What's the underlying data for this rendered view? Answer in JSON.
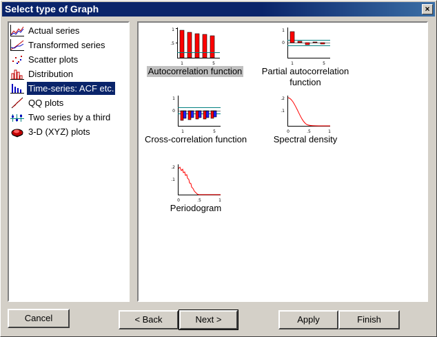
{
  "window": {
    "title": "Select type of Graph",
    "close_label": "×"
  },
  "graph_types": [
    {
      "label": "Actual series",
      "icon": "actual-series-icon"
    },
    {
      "label": "Transformed series",
      "icon": "transformed-series-icon"
    },
    {
      "label": "Scatter plots",
      "icon": "scatter-plots-icon"
    },
    {
      "label": "Distribution",
      "icon": "distribution-icon"
    },
    {
      "label": "Time-series: ACF etc.",
      "icon": "time-series-icon",
      "selected": true
    },
    {
      "label": "QQ plots",
      "icon": "qq-plots-icon"
    },
    {
      "label": "Two series by a third",
      "icon": "two-series-icon"
    },
    {
      "label": "3-D (XYZ) plots",
      "icon": "3d-plots-icon"
    }
  ],
  "graphs": {
    "acf": {
      "caption": "Autocorrelation function",
      "selected": true
    },
    "pacf": {
      "caption_line1": "Partial autocorrelation",
      "caption_line2": "function"
    },
    "ccf": {
      "caption": "Cross-correlation function"
    },
    "spectral": {
      "caption": "Spectral density"
    },
    "periodogram": {
      "caption": "Periodogram"
    }
  },
  "thumb_labels": {
    "acf_y_top": "1",
    "acf_y_mid": ".5",
    "acf_x_1": "1",
    "acf_x_5": "5",
    "pacf_y_top": "1",
    "pacf_y_mid": "0",
    "pacf_x_1": "1",
    "pacf_x_5": "5",
    "ccf_y_top": "1",
    "ccf_y_mid": "0",
    "ccf_x_1": "1",
    "ccf_x_5": "5",
    "sd_y_top": ".2",
    "sd_y_mid": ".1",
    "sd_x_0": "0",
    "sd_x_5": ".5",
    "sd_x_1": "1",
    "pg_y_top": ".2",
    "pg_y_mid": ".1",
    "pg_x_0": "0",
    "pg_x_5": ".5",
    "pg_x_1": "1"
  },
  "buttons": {
    "cancel": "Cancel",
    "back": "< Back",
    "next": "Next >",
    "apply": "Apply",
    "finish": "Finish"
  },
  "colors": {
    "titlebar": "#0a246a",
    "selection": "#0a246a",
    "bar_red": "#ff0000",
    "bar_blue": "#2020ff",
    "line_teal": "#008080"
  }
}
